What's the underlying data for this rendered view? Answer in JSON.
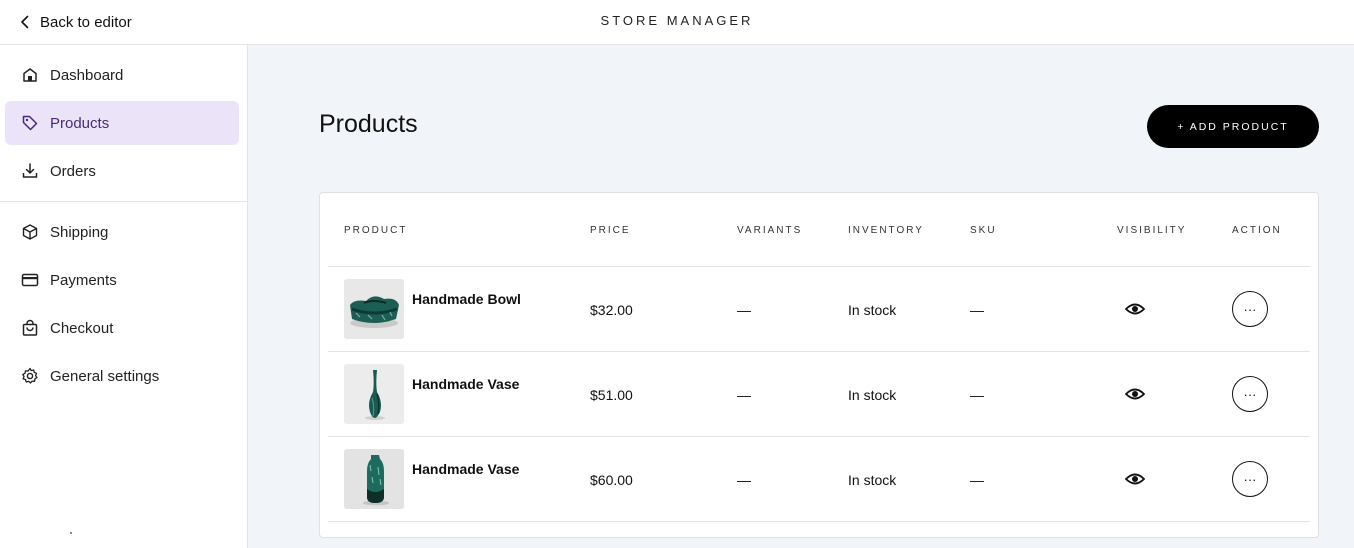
{
  "header": {
    "back_label": "Back to editor",
    "app_title": "STORE MANAGER"
  },
  "sidebar": {
    "items": [
      {
        "label": "Dashboard",
        "icon": "home-icon"
      },
      {
        "label": "Products",
        "icon": "tag-icon",
        "active": true
      },
      {
        "label": "Orders",
        "icon": "download-icon"
      },
      {
        "label": "Shipping",
        "icon": "box-icon"
      },
      {
        "label": "Payments",
        "icon": "card-icon"
      },
      {
        "label": "Checkout",
        "icon": "bag-icon"
      },
      {
        "label": "General settings",
        "icon": "gear-icon"
      }
    ]
  },
  "main": {
    "title": "Products",
    "add_button_label": "+ ADD PRODUCT"
  },
  "table": {
    "columns": [
      "PRODUCT",
      "PRICE",
      "VARIANTS",
      "INVENTORY",
      "SKU",
      "VISIBILITY",
      "ACTION"
    ],
    "rows": [
      {
        "name": "Handmade Bowl",
        "price": "$32.00",
        "variants": "—",
        "inventory": "In stock",
        "sku": "—",
        "visibility_icon": "eye-icon",
        "action_label": "···"
      },
      {
        "name": "Handmade Vase",
        "price": "$51.00",
        "variants": "—",
        "inventory": "In stock",
        "sku": "—",
        "visibility_icon": "eye-icon",
        "action_label": "···"
      },
      {
        "name": "Handmade Vase",
        "price": "$60.00",
        "variants": "—",
        "inventory": "In stock",
        "sku": "—",
        "visibility_icon": "eye-icon",
        "action_label": "···"
      }
    ]
  },
  "colors": {
    "active_nav_bg": "#ebe4f8",
    "active_nav_text": "#4a2a78",
    "page_bg": "#f1f4f9",
    "accent_button": "#000000",
    "product_glaze": "#1d6b5e"
  }
}
